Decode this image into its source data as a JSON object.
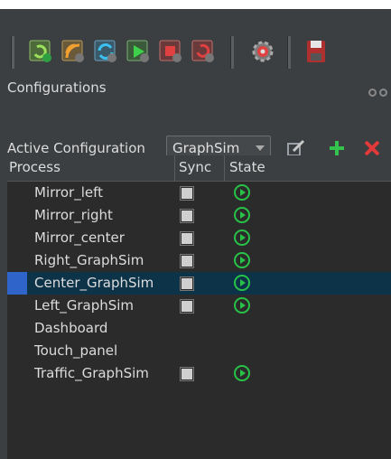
{
  "toolbar": {
    "icons": [
      "refresh-green-icon",
      "signal-orange-icon",
      "sync-blue-icon",
      "play-green-icon",
      "stop-red-icon",
      "restart-red-icon",
      "settings-icon",
      "save-icon"
    ]
  },
  "panel": {
    "title": "Configurations"
  },
  "active_config": {
    "label": "Active Configuration",
    "selected": "GraphSim"
  },
  "table": {
    "columns": [
      "Process",
      "Sync",
      "State"
    ],
    "rows": [
      {
        "name": "Mirror_left",
        "sync": true,
        "state": "running",
        "selected": false
      },
      {
        "name": "Mirror_right",
        "sync": true,
        "state": "running",
        "selected": false
      },
      {
        "name": "Mirror_center",
        "sync": true,
        "state": "running",
        "selected": false
      },
      {
        "name": "Right_GraphSim",
        "sync": true,
        "state": "running",
        "selected": false
      },
      {
        "name": "Center_GraphSim",
        "sync": true,
        "state": "running",
        "selected": true
      },
      {
        "name": "Left_GraphSim",
        "sync": true,
        "state": "running",
        "selected": false
      },
      {
        "name": "Dashboard",
        "sync": false,
        "state": "",
        "selected": false
      },
      {
        "name": "Touch_panel",
        "sync": false,
        "state": "",
        "selected": false
      },
      {
        "name": "Traffic_GraphSim",
        "sync": true,
        "state": "running",
        "selected": false
      }
    ]
  },
  "colors": {
    "background": "#3c3f41",
    "table_bg": "#2b2b2b",
    "selection": "#0d3349",
    "selection_marker": "#2f65ca",
    "state_green": "#27c247",
    "add_green": "#33c24d",
    "remove_red": "#e23a3a"
  }
}
